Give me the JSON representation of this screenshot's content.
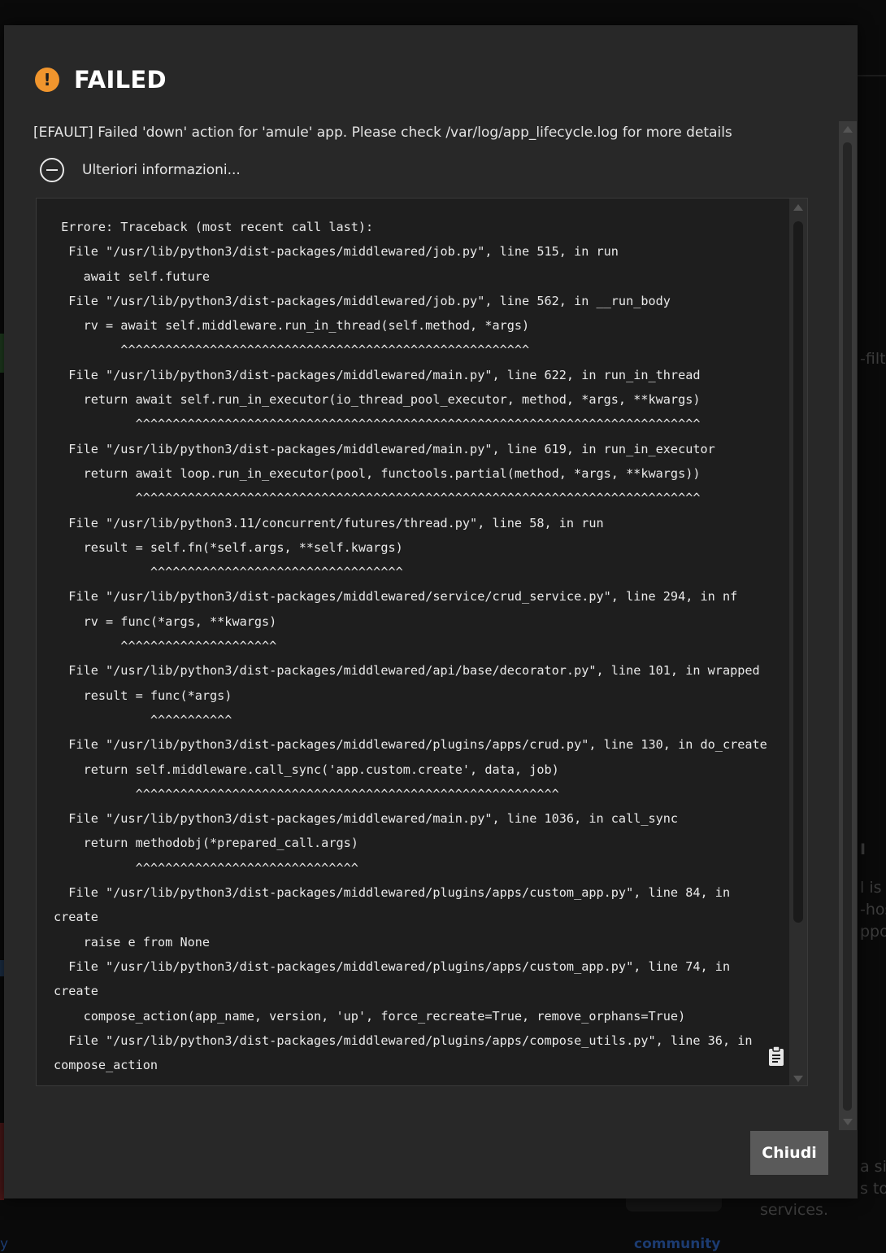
{
  "dialog": {
    "status_icon": "warning-circle-icon",
    "title": "FAILED",
    "message": "[EFAULT] Failed 'down' action for 'amule' app. Please check /var/log/app_lifecycle.log for more details",
    "more_info_icon": "minus-circle-icon",
    "more_info_label": "Ulteriori informazioni...",
    "traceback": " Errore: Traceback (most recent call last):\n  File \"/usr/lib/python3/dist-packages/middlewared/job.py\", line 515, in run\n    await self.future\n  File \"/usr/lib/python3/dist-packages/middlewared/job.py\", line 562, in __run_body\n    rv = await self.middleware.run_in_thread(self.method, *args)\n         ^^^^^^^^^^^^^^^^^^^^^^^^^^^^^^^^^^^^^^^^^^^^^^^^^^^^^^^\n  File \"/usr/lib/python3/dist-packages/middlewared/main.py\", line 622, in run_in_thread\n    return await self.run_in_executor(io_thread_pool_executor, method, *args, **kwargs)\n           ^^^^^^^^^^^^^^^^^^^^^^^^^^^^^^^^^^^^^^^^^^^^^^^^^^^^^^^^^^^^^^^^^^^^^^^^^^^^\n  File \"/usr/lib/python3/dist-packages/middlewared/main.py\", line 619, in run_in_executor\n    return await loop.run_in_executor(pool, functools.partial(method, *args, **kwargs))\n           ^^^^^^^^^^^^^^^^^^^^^^^^^^^^^^^^^^^^^^^^^^^^^^^^^^^^^^^^^^^^^^^^^^^^^^^^^^^^\n  File \"/usr/lib/python3.11/concurrent/futures/thread.py\", line 58, in run\n    result = self.fn(*self.args, **self.kwargs)\n             ^^^^^^^^^^^^^^^^^^^^^^^^^^^^^^^^^^\n  File \"/usr/lib/python3/dist-packages/middlewared/service/crud_service.py\", line 294, in nf\n    rv = func(*args, **kwargs)\n         ^^^^^^^^^^^^^^^^^^^^^\n  File \"/usr/lib/python3/dist-packages/middlewared/api/base/decorator.py\", line 101, in wrapped\n    result = func(*args)\n             ^^^^^^^^^^^\n  File \"/usr/lib/python3/dist-packages/middlewared/plugins/apps/crud.py\", line 130, in do_create\n    return self.middleware.call_sync('app.custom.create', data, job)\n           ^^^^^^^^^^^^^^^^^^^^^^^^^^^^^^^^^^^^^^^^^^^^^^^^^^^^^^^^^\n  File \"/usr/lib/python3/dist-packages/middlewared/main.py\", line 1036, in call_sync\n    return methodobj(*prepared_call.args)\n           ^^^^^^^^^^^^^^^^^^^^^^^^^^^^^^\n  File \"/usr/lib/python3/dist-packages/middlewared/plugins/apps/custom_app.py\", line 84, in create\n    raise e from None\n  File \"/usr/lib/python3/dist-packages/middlewared/plugins/apps/custom_app.py\", line 74, in create\n    compose_action(app_name, version, 'up', force_recreate=True, remove_orphans=True)\n  File \"/usr/lib/python3/dist-packages/middlewared/plugins/apps/compose_utils.py\", line 36, in compose_action",
    "copy_icon": "clipboard-copy-icon",
    "close_label": "Chiudi"
  },
  "background": {
    "fragments": [
      "-filt",
      "I",
      "l is",
      "-hos",
      "ppo",
      "a si",
      "s to",
      "services.",
      "community",
      "y"
    ]
  },
  "colors": {
    "dialog_bg": "#282828",
    "warning": "#f0952d",
    "close_button": "#5a5a5a"
  }
}
